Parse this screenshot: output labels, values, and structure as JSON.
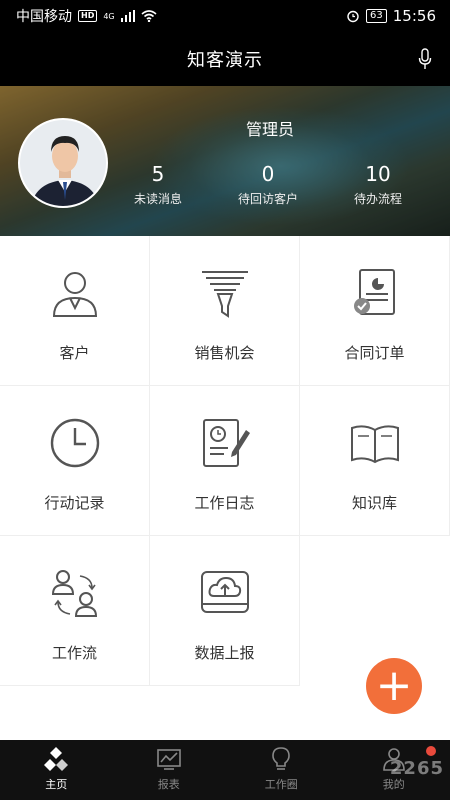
{
  "status_bar": {
    "carrier": "中国移动",
    "hd": "HD",
    "network": "4G",
    "battery": "63",
    "time": "15:56"
  },
  "header": {
    "title": "知客演示"
  },
  "profile": {
    "name": "管理员",
    "stats": [
      {
        "value": "5",
        "label": "未读消息"
      },
      {
        "value": "0",
        "label": "待回访客户"
      },
      {
        "value": "10",
        "label": "待办流程"
      }
    ]
  },
  "grid": {
    "items": [
      {
        "label": "客户",
        "icon": "customer-icon"
      },
      {
        "label": "销售机会",
        "icon": "funnel-icon"
      },
      {
        "label": "合同订单",
        "icon": "contract-icon"
      },
      {
        "label": "行动记录",
        "icon": "clock-icon"
      },
      {
        "label": "工作日志",
        "icon": "work-log-icon"
      },
      {
        "label": "知识库",
        "icon": "book-icon"
      },
      {
        "label": "工作流",
        "icon": "workflow-icon"
      },
      {
        "label": "数据上报",
        "icon": "cloud-upload-icon"
      }
    ]
  },
  "fab": {
    "label": "+"
  },
  "bottom_nav": {
    "tabs": [
      {
        "label": "主页",
        "icon": "home-icon",
        "active": true
      },
      {
        "label": "报表",
        "icon": "report-icon",
        "active": false
      },
      {
        "label": "工作圈",
        "icon": "lightbulb-icon",
        "active": false
      },
      {
        "label": "我的",
        "icon": "profile-icon",
        "active": false
      }
    ]
  },
  "watermark": "2265",
  "colors": {
    "accent": "#f26f3a",
    "badge": "#e94a3c"
  }
}
